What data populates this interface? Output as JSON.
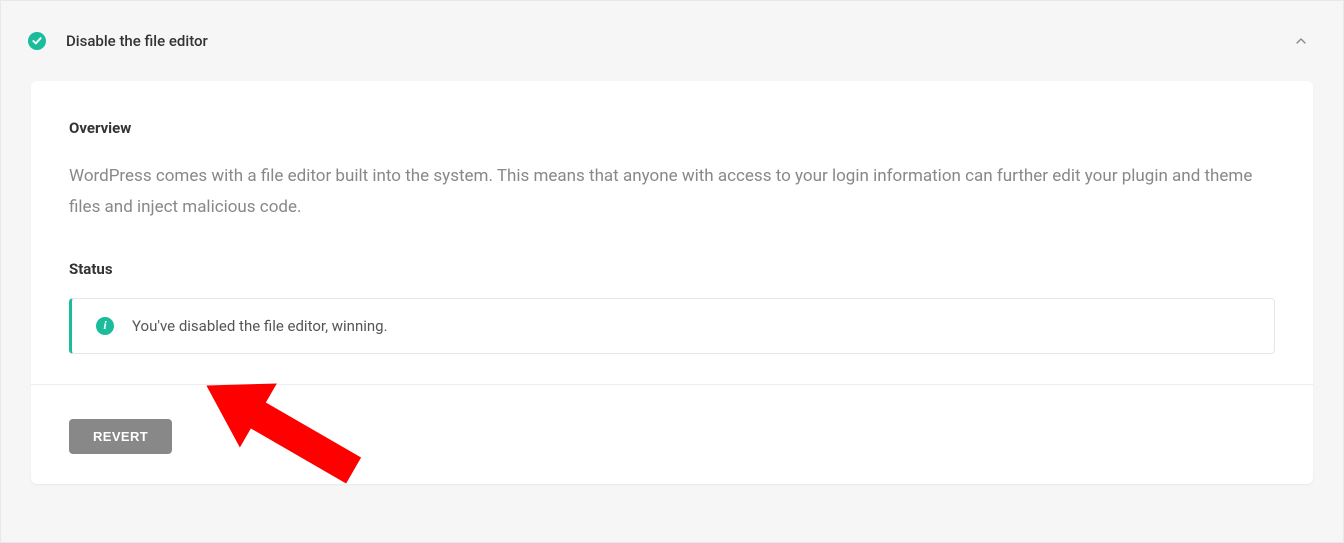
{
  "panel": {
    "title": "Disable the file editor"
  },
  "overview": {
    "heading": "Overview",
    "text": "WordPress comes with a file editor built into the system. This means that anyone with access to your login information can further edit your plugin and theme files and inject malicious code."
  },
  "status": {
    "heading": "Status",
    "message": "You've disabled the file editor, winning."
  },
  "actions": {
    "revert_label": "REVERT"
  },
  "colors": {
    "accent": "#1abc9c",
    "annotation_arrow": "#ff0000"
  }
}
